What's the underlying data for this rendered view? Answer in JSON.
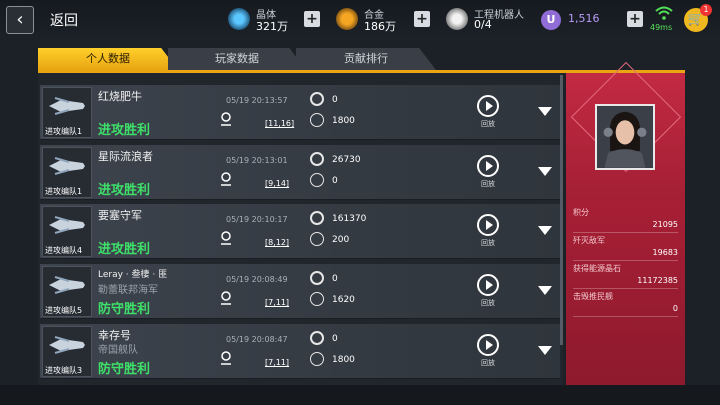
{
  "header": {
    "back_label": "返回",
    "resources": [
      {
        "name": "crystal",
        "label": "晶体",
        "value": "321万",
        "icon": "crystal-icon"
      },
      {
        "name": "alloy",
        "label": "合金",
        "value": "186万",
        "icon": "alloy-icon"
      },
      {
        "name": "robot",
        "label": "工程机器人",
        "value": "0/4",
        "icon": "robot-icon"
      }
    ],
    "u_coin": {
      "symbol": "U",
      "value": "1,516"
    },
    "ping": "49ms",
    "cart_badge": "1"
  },
  "tabs": [
    {
      "label": "个人数据",
      "active": true
    },
    {
      "label": "玩家数据",
      "active": false
    },
    {
      "label": "贡献排行",
      "active": false
    }
  ],
  "records": [
    {
      "fleet": "进攻编队1",
      "name": "红烧肥牛",
      "subtitle": "",
      "result": "进攻胜利",
      "time": "05/19 20:13:57",
      "coord": "[11,16]",
      "stat_top": "0",
      "stat_bottom": "1800",
      "replay": "回放"
    },
    {
      "fleet": "进攻编队1",
      "name": "星际流浪者",
      "subtitle": "",
      "result": "进攻胜利",
      "time": "05/19 20:13:01",
      "coord": "[9,14]",
      "stat_top": "26730",
      "stat_bottom": "0",
      "replay": "回放"
    },
    {
      "fleet": "进攻编队4",
      "name": "要塞守军",
      "subtitle": "",
      "result": "进攻胜利",
      "time": "05/19 20:10:17",
      "coord": "[8,12]",
      "stat_top": "161370",
      "stat_bottom": "200",
      "replay": "回放"
    },
    {
      "fleet": "进攻编队5",
      "name": "Leray · 叁棲 · 匪",
      "subtitle": "勒蕾联邦海军",
      "result": "防守胜利",
      "time": "05/19 20:08:49",
      "coord": "[7,11]",
      "stat_top": "0",
      "stat_bottom": "1620",
      "replay": "回放"
    },
    {
      "fleet": "进攻编队3",
      "name": "幸存号",
      "subtitle": "帝国舰队",
      "result": "防守胜利",
      "time": "05/19 20:08:47",
      "coord": "[7,11]",
      "stat_top": "0",
      "stat_bottom": "1800",
      "replay": "回放"
    }
  ],
  "profile": {
    "stats": [
      {
        "label": "积分",
        "value": "21095"
      },
      {
        "label": "歼灭敌军",
        "value": "19683"
      },
      {
        "label": "获得能源晶石",
        "value": "11172385"
      },
      {
        "label": "击毁推民舰",
        "value": "0"
      }
    ]
  },
  "colors": {
    "accent": "#e9a512",
    "victory": "#3ee06a",
    "panel": "#b8223a"
  }
}
